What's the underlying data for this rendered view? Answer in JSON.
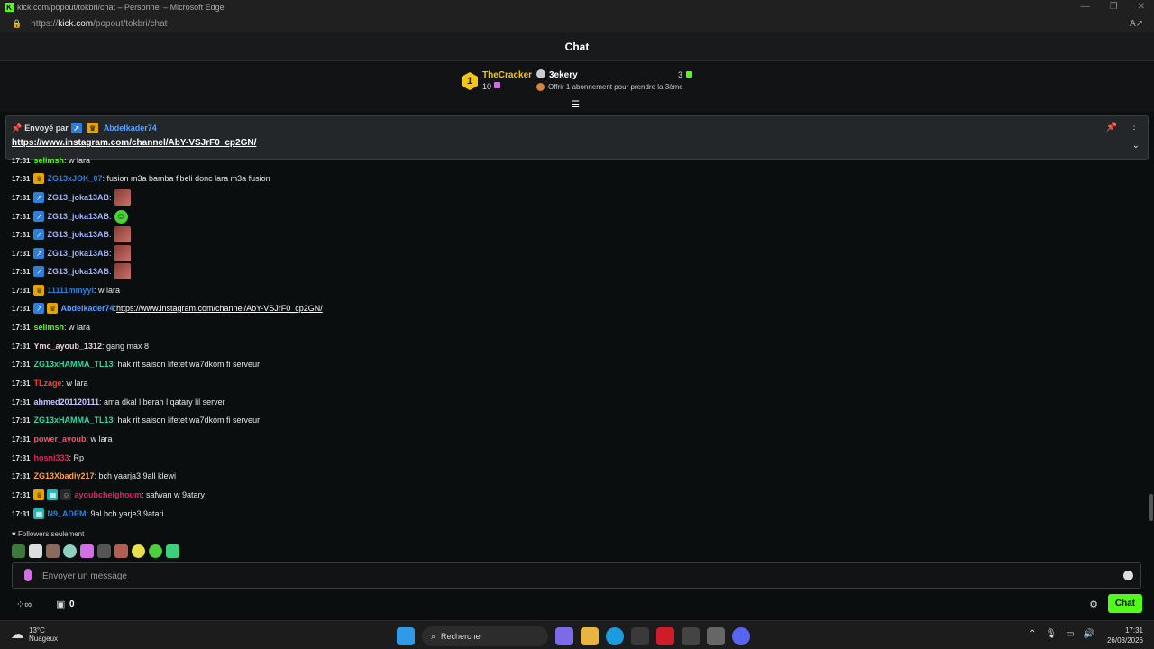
{
  "window": {
    "title": "kick.com/popout/tokbri/chat – Personnel – Microsoft Edge",
    "url_prefix": "https://",
    "url_domain": "kick.com",
    "url_path": "/popout/tokbri/chat"
  },
  "chat": {
    "title": "Chat"
  },
  "leaderboard": {
    "first": {
      "rank": "1",
      "name": "TheCracker",
      "count": "10"
    },
    "second": {
      "name": "3ekery",
      "count": "3",
      "hint": "Offrir 1 abonnement pour prendre la 3ème"
    }
  },
  "pinned": {
    "sent_by_label": "Envoyé par",
    "user": "Abdelkader74",
    "link": "https://www.instagram.com/channel/AbY-VSJrF0_cp2GN/"
  },
  "messages": [
    {
      "time": "17:31",
      "user": "selimsh",
      "text": ": w lara",
      "color": "#53fc18",
      "badges": []
    },
    {
      "time": "17:31",
      "user": "ZG13xJOK_07",
      "text": ": fusion m3a bamba fibeli donc lara m3a fusion",
      "color": "#2f7fd9",
      "badges": [
        "crown"
      ]
    },
    {
      "time": "17:31",
      "user": "ZG13_joka13AB",
      "text": ":",
      "color": "#9fb3ff",
      "badges": [
        "vip"
      ],
      "emote": "img"
    },
    {
      "time": "17:31",
      "user": "ZG13_joka13AB",
      "text": ":",
      "color": "#9fb3ff",
      "badges": [
        "vip"
      ],
      "emote": "smile"
    },
    {
      "time": "17:31",
      "user": "ZG13_joka13AB",
      "text": ":",
      "color": "#9fb3ff",
      "badges": [
        "vip"
      ],
      "emote": "img"
    },
    {
      "time": "17:31",
      "user": "ZG13_joka13AB",
      "text": ":",
      "color": "#9fb3ff",
      "badges": [
        "vip"
      ],
      "emote": "img"
    },
    {
      "time": "17:31",
      "user": "ZG13_joka13AB",
      "text": ":",
      "color": "#9fb3ff",
      "badges": [
        "vip"
      ],
      "emote": "img"
    },
    {
      "time": "17:31",
      "user": "11111mmyyi",
      "text": ": w lara",
      "color": "#2f7fd9",
      "badges": [
        "crown"
      ]
    },
    {
      "time": "17:31",
      "user": "Abdelkader74",
      "text": ": ",
      "link": "https://www.instagram.com/channel/AbY-VSJrF0_cp2GN/",
      "color": "#5aa0ff",
      "badges": [
        "vip",
        "crown"
      ]
    },
    {
      "time": "17:31",
      "user": "selimsh",
      "text": ": w lara",
      "color": "#53fc18",
      "badges": []
    },
    {
      "time": "17:31",
      "user": "Ymc_ayoub_1312",
      "text": ": gang max 8",
      "color": "#e8d3d3",
      "badges": []
    },
    {
      "time": "17:31",
      "user": "ZG13xHAMMA_TL13",
      "text": ": hak rit saison lifetet wa7dkom fi serveur",
      "color": "#36d6a0",
      "badges": []
    },
    {
      "time": "17:31",
      "user": "TLzage",
      "text": ": w lara",
      "color": "#ff3b3b",
      "badges": []
    },
    {
      "time": "17:31",
      "user": "ahmed201120111",
      "text": ": ama dkal l berah l qatary lil server",
      "color": "#c5c5ff",
      "badges": []
    },
    {
      "time": "17:31",
      "user": "ZG13xHAMMA_TL13",
      "text": ": hak rit saison lifetet wa7dkom fi serveur",
      "color": "#36d6a0",
      "badges": []
    },
    {
      "time": "17:31",
      "user": "power_ayoub",
      "text": ": w lara",
      "color": "#ff4f6a",
      "badges": []
    },
    {
      "time": "17:31",
      "user": "hosni333",
      "text": ": Rp",
      "color": "#e0245e",
      "badges": []
    },
    {
      "time": "17:31",
      "user": "ZG13Xbadiy217",
      "text": ": bch yaarja3 9all klewi",
      "color": "#ff9f43",
      "badges": []
    },
    {
      "time": "17:31",
      "user": "ayoubchelghoum",
      "text": ": safwan w 9atary",
      "color": "#e0245e",
      "badges": [
        "crown",
        "sub",
        "og"
      ]
    },
    {
      "time": "17:31",
      "user": "N9_ADEM",
      "text": ": 9al bch yarje3 9atari",
      "color": "#2f7fd9",
      "badges": [
        "sub"
      ]
    }
  ],
  "followers_label": "Followers seulement",
  "input": {
    "placeholder": "Envoyer un message"
  },
  "bottom": {
    "points": "0",
    "chat_button": "Chat"
  },
  "taskbar": {
    "temp": "13°C",
    "weather": "Nuageux",
    "search": "Rechercher",
    "time": "17:31",
    "date": "26/03/2026"
  },
  "colors": {
    "accent": "#53fc18",
    "background": "#0b0e0f"
  }
}
